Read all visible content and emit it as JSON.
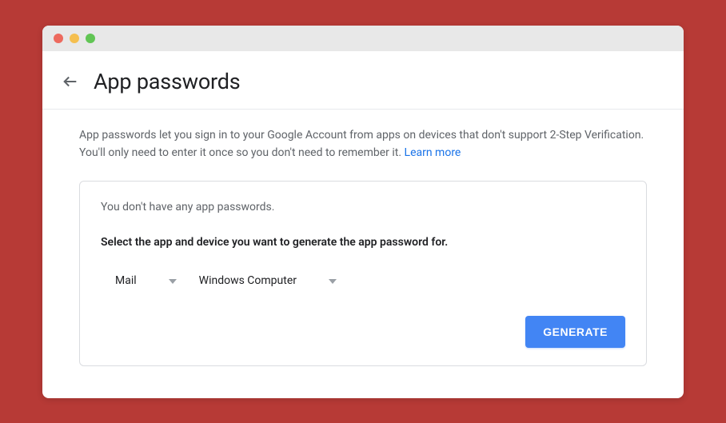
{
  "header": {
    "title": "App passwords"
  },
  "description": {
    "text": "App passwords let you sign in to your Google Account from apps on devices that don't support 2-Step Verification. You'll only need to enter it once so you don't need to remember it. ",
    "learn_more": "Learn more"
  },
  "card": {
    "empty_state": "You don't have any app passwords.",
    "instruction": "Select the app and device you want to generate the app password for.",
    "app_select": "Mail",
    "device_select": "Windows Computer",
    "generate_button": "GENERATE"
  }
}
